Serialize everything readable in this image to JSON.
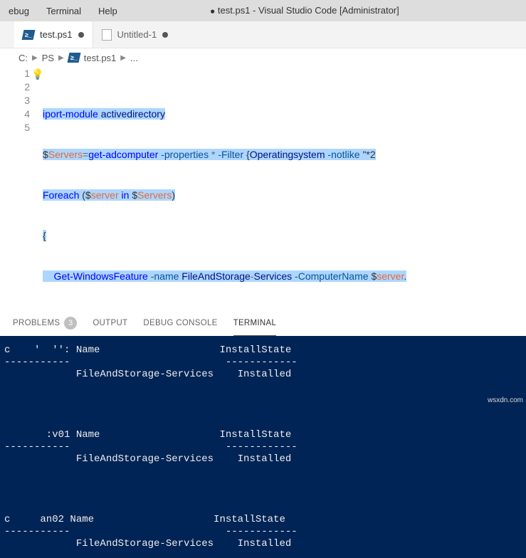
{
  "menu": {
    "debug": "ebug",
    "terminal": "Terminal",
    "help": "Help"
  },
  "window": {
    "dirty_mark": "●",
    "title": "test.ps1 - Visual Studio Code [Administrator]"
  },
  "tabs": [
    {
      "label": "test.ps1",
      "icon": "ps",
      "active": true,
      "dirty": true
    },
    {
      "label": "Untitled-1",
      "icon": "file",
      "active": false,
      "dirty": true
    }
  ],
  "breadcrumb": {
    "root": "C:",
    "folder": "PS",
    "file": "test.ps1",
    "tail": "..."
  },
  "editor": {
    "lines": [
      "1",
      "2",
      "3",
      "4",
      "5"
    ],
    "code": {
      "l1a": "i",
      "l1b": "port-module",
      "l1c": " activedirectory",
      "l2a": "$",
      "l2b": "Servers",
      "l2c": "=",
      "l2d": "get-adcomputer",
      "l2e": " -properties ",
      "l2f": "*",
      "l2g": " -Filter ",
      "l2h": "{",
      "l2i": "Operatingsystem",
      "l2j": " -notlike ",
      "l2k": "\"*2",
      "l3a": "Foreach",
      "l3b": " (",
      "l3c": "$",
      "l3d": "server",
      "l3e": " in ",
      "l3f": "$",
      "l3g": "Servers",
      "l3h": ")",
      "l4a": "{",
      "l5a": "    Get-WindowsFeature",
      "l5b": " -name ",
      "l5c": "FileAndStorage",
      "l5d": "-",
      "l5e": "Services",
      "l5f": " -ComputerName ",
      "l5g": "$",
      "l5h": "server",
      "l5i": "."
    }
  },
  "panel": {
    "tabs": {
      "problems": "PROBLEMS",
      "problems_count": "3",
      "output": "OUTPUT",
      "debug": "DEBUG CONSOLE",
      "terminal": "TERMINAL"
    }
  },
  "terminal_output": "c    '  '': Name                    InstallState\n-----------                          ------------\n            FileAndStorage-Services    Installed\n\n\n\n\n       :v01 Name                    InstallState\n-----------                          ------------\n            FileAndStorage-Services    Installed\n\n\n\n\nc     an02 Name                    InstallState\n-----------                          ------------\n            FileAndStorage-Services    Installed\n",
  "watermark": "wsxdn.com"
}
